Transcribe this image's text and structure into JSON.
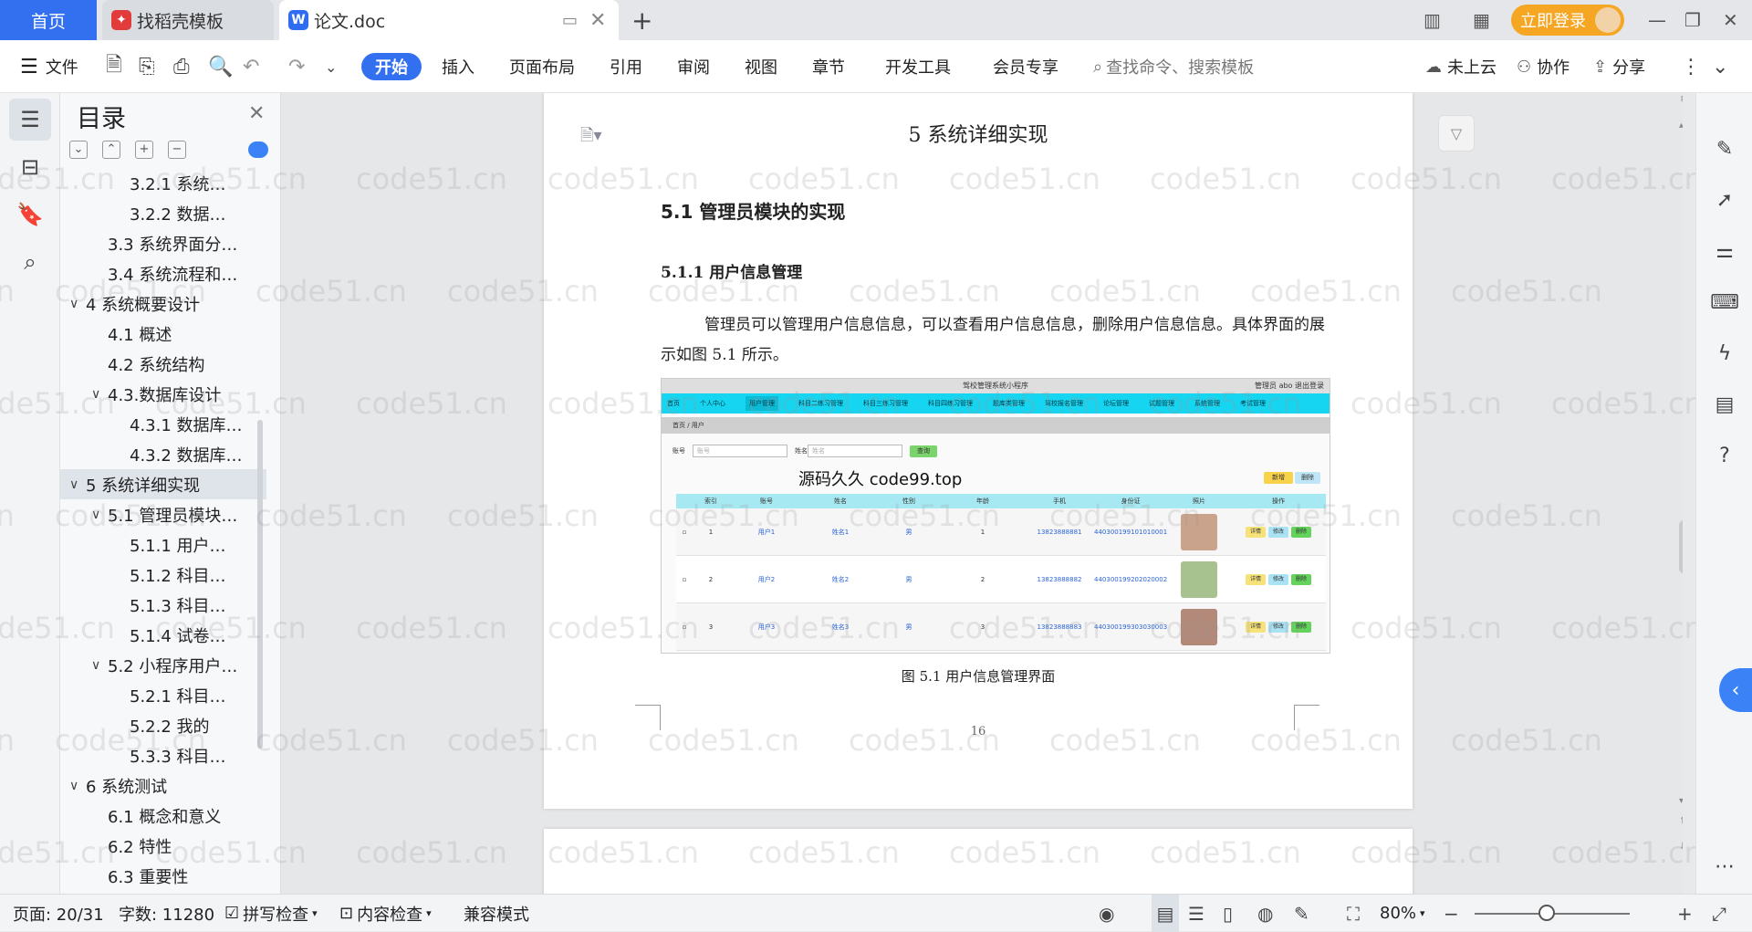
{
  "tabs": {
    "home": "首页",
    "template": "找稻壳模板",
    "doc": "论文.doc"
  },
  "titlebar": {
    "login": "立即登录"
  },
  "toolbar": {
    "file": "文件",
    "menus": [
      "开始",
      "插入",
      "页面布局",
      "引用",
      "审阅",
      "视图",
      "章节",
      "开发工具",
      "会员专享"
    ],
    "search_placeholder": "查找命令、搜索模板",
    "cloud": "未上云",
    "collab": "协作",
    "share": "分享"
  },
  "toc": {
    "title": "目录",
    "items": [
      {
        "label": "3.2.1 系统…",
        "level": 3
      },
      {
        "label": "3.2.2 数据…",
        "level": 3
      },
      {
        "label": "3.3 系统界面分…",
        "level": 2
      },
      {
        "label": "3.4 系统流程和…",
        "level": 2
      },
      {
        "label": "4 系统概要设计",
        "level": 1,
        "caret": "∨"
      },
      {
        "label": "4.1 概述",
        "level": 2
      },
      {
        "label": "4.2 系统结构",
        "level": 2
      },
      {
        "label": "4.3.数据库设计",
        "level": 2,
        "caret": "∨"
      },
      {
        "label": "4.3.1 数据库…",
        "level": 3
      },
      {
        "label": "4.3.2 数据库…",
        "level": 3
      },
      {
        "label": "5 系统详细实现",
        "level": 1,
        "caret": "∨",
        "selected": true
      },
      {
        "label": "5.1 管理员模块…",
        "level": 2,
        "caret": "∨"
      },
      {
        "label": "5.1.1 用户…",
        "level": 3
      },
      {
        "label": "5.1.2 科目…",
        "level": 3
      },
      {
        "label": "5.1.3 科目…",
        "level": 3
      },
      {
        "label": "5.1.4 试卷…",
        "level": 3
      },
      {
        "label": "5.2 小程序用户…",
        "level": 2,
        "caret": "∨"
      },
      {
        "label": "5.2.1 科目…",
        "level": 3
      },
      {
        "label": "5.2.2 我的",
        "level": 3
      },
      {
        "label": "5.3.3 科目…",
        "level": 3
      },
      {
        "label": "6 系统测试",
        "level": 1,
        "caret": "∨"
      },
      {
        "label": "6.1 概念和意义",
        "level": 2
      },
      {
        "label": "6.2 特性",
        "level": 2
      },
      {
        "label": "6.3 重要性",
        "level": 2
      }
    ]
  },
  "document": {
    "chapter_title": "5 系统详细实现",
    "h2": "5.1  管理员模块的实现",
    "h3": "5.1.1  用户信息管理",
    "paragraph": "管理员可以管理用户信息信息，可以查看用户信息信息，删除用户信息信息。具体界面的展示如图 5.1 所示。",
    "figure": {
      "app_title": "驾校管理系统小程序",
      "user_info": "管理员 abo   退出登录",
      "nav": [
        "首页",
        "个人中心",
        "用户管理",
        "科目二练习管理",
        "科目三练习管理",
        "科目四练习管理",
        "题库类管理",
        "驾校报名管理",
        "论坛管理",
        "试题管理",
        "系统管理",
        "考试管理"
      ],
      "crumb": "首页 / 用户",
      "search": {
        "label1": "账号",
        "ph1": "账号",
        "label2": "姓名",
        "ph2": "姓名",
        "btn": "查询",
        "add": "新增",
        "del": "删除"
      },
      "watermark": "源码久久 code99.top",
      "columns": [
        "",
        "索引",
        "账号",
        "姓名",
        "性别",
        "年龄",
        "手机",
        "身份证",
        "照片",
        "操作"
      ],
      "rows": [
        {
          "idx": "1",
          "acct": "用户1",
          "name": "姓名1",
          "sex": "男",
          "age": "1",
          "phone": "13823888881",
          "id": "440300199101010001"
        },
        {
          "idx": "2",
          "acct": "用户2",
          "name": "姓名2",
          "sex": "男",
          "age": "2",
          "phone": "13823888882",
          "id": "440300199202020002"
        },
        {
          "idx": "3",
          "acct": "用户3",
          "name": "姓名3",
          "sex": "男",
          "age": "3",
          "phone": "13823888883",
          "id": "440300199303030003"
        }
      ],
      "ops": [
        "详情",
        "修改",
        "删除"
      ]
    },
    "caption": "图 5.1  用户信息管理界面",
    "page_number": "16"
  },
  "watermark_text": "code51.cn",
  "status": {
    "page": "页面: 20/31",
    "words": "字数: 11280",
    "spell": "拼写检查",
    "content": "内容检查",
    "compat": "兼容模式",
    "zoom": "80%"
  },
  "colors": {
    "accent": "#3370f0",
    "login": "#f5a623",
    "fig_nav": "#16d5f0"
  }
}
